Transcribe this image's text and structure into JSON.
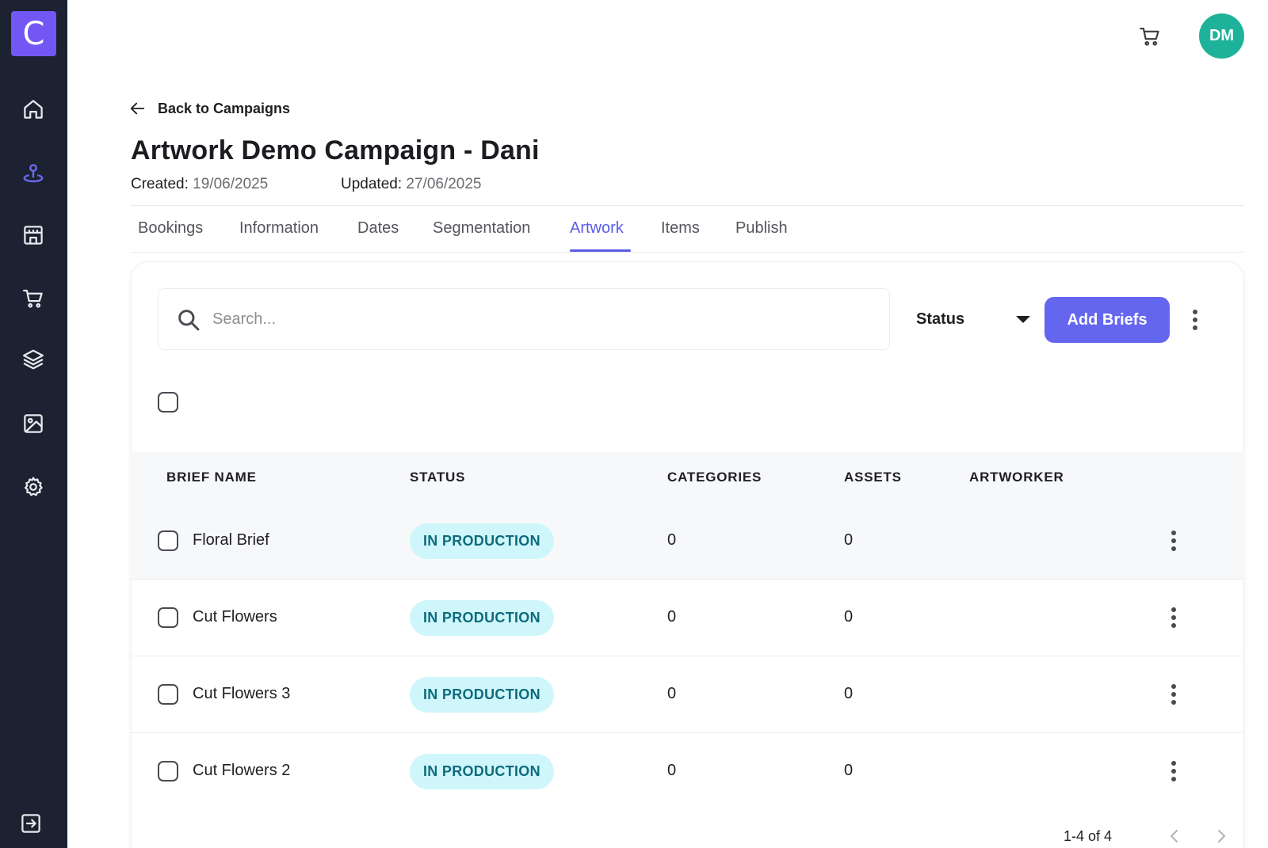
{
  "app": {
    "logo_letter": "C",
    "brand_color": "#7257f5",
    "accent_color": "#6466ef",
    "sidebar_color": "#1c2232"
  },
  "sidebar": {
    "items": [
      {
        "icon": "home-icon",
        "active": false
      },
      {
        "icon": "campaign-pin-icon",
        "active": true
      },
      {
        "icon": "store-icon",
        "active": false
      },
      {
        "icon": "cart-icon",
        "active": false
      },
      {
        "icon": "layers-icon",
        "active": false
      },
      {
        "icon": "image-icon",
        "active": false
      },
      {
        "icon": "settings-icon",
        "active": false
      }
    ],
    "bottom_icon": "logout-icon"
  },
  "topbar": {
    "cart_icon": "cart-icon",
    "avatar_initials": "DM"
  },
  "header": {
    "back_label": "Back to Campaigns",
    "title": "Artwork Demo Campaign - Dani",
    "created_label": "Created:",
    "created_value": "19/06/2025",
    "updated_label": "Updated:",
    "updated_value": "27/06/2025"
  },
  "tabs": [
    {
      "label": "Bookings",
      "active": false
    },
    {
      "label": "Information",
      "active": false
    },
    {
      "label": "Dates",
      "active": false
    },
    {
      "label": "Segmentation",
      "active": false
    },
    {
      "label": "Artwork",
      "active": true
    },
    {
      "label": "Items",
      "active": false
    },
    {
      "label": "Publish",
      "active": false
    }
  ],
  "toolbar": {
    "search_placeholder": "Search...",
    "search_value": "",
    "status_filter_label": "Status",
    "add_button_label": "Add Briefs"
  },
  "table": {
    "columns": [
      "BRIEF NAME",
      "STATUS",
      "CATEGORIES",
      "ASSETS",
      "ARTWORKER"
    ],
    "rows": [
      {
        "name": "Floral Brief",
        "status": "IN PRODUCTION",
        "categories": "0",
        "assets": "0",
        "artworker": ""
      },
      {
        "name": "Cut Flowers",
        "status": "IN PRODUCTION",
        "categories": "0",
        "assets": "0",
        "artworker": ""
      },
      {
        "name": "Cut Flowers 3",
        "status": "IN PRODUCTION",
        "categories": "0",
        "assets": "0",
        "artworker": ""
      },
      {
        "name": "Cut Flowers 2",
        "status": "IN PRODUCTION",
        "categories": "0",
        "assets": "0",
        "artworker": ""
      }
    ]
  },
  "pagination": {
    "range_text": "1-4 of 4"
  }
}
